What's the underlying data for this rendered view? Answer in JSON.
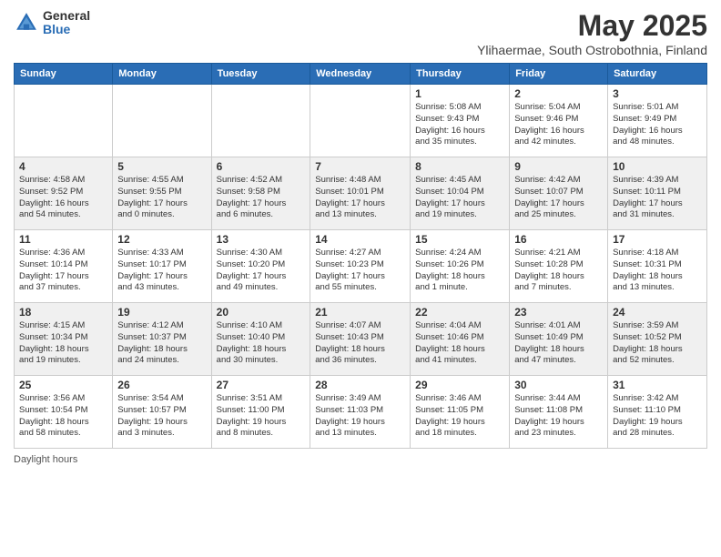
{
  "logo": {
    "general": "General",
    "blue": "Blue"
  },
  "title": "May 2025",
  "subtitle": "Ylihaermae, South Ostrobothnia, Finland",
  "headers": [
    "Sunday",
    "Monday",
    "Tuesday",
    "Wednesday",
    "Thursday",
    "Friday",
    "Saturday"
  ],
  "days_label": "Daylight hours",
  "weeks": [
    [
      {
        "num": "",
        "info": ""
      },
      {
        "num": "",
        "info": ""
      },
      {
        "num": "",
        "info": ""
      },
      {
        "num": "",
        "info": ""
      },
      {
        "num": "1",
        "info": "Sunrise: 5:08 AM\nSunset: 9:43 PM\nDaylight: 16 hours\nand 35 minutes."
      },
      {
        "num": "2",
        "info": "Sunrise: 5:04 AM\nSunset: 9:46 PM\nDaylight: 16 hours\nand 42 minutes."
      },
      {
        "num": "3",
        "info": "Sunrise: 5:01 AM\nSunset: 9:49 PM\nDaylight: 16 hours\nand 48 minutes."
      }
    ],
    [
      {
        "num": "4",
        "info": "Sunrise: 4:58 AM\nSunset: 9:52 PM\nDaylight: 16 hours\nand 54 minutes."
      },
      {
        "num": "5",
        "info": "Sunrise: 4:55 AM\nSunset: 9:55 PM\nDaylight: 17 hours\nand 0 minutes."
      },
      {
        "num": "6",
        "info": "Sunrise: 4:52 AM\nSunset: 9:58 PM\nDaylight: 17 hours\nand 6 minutes."
      },
      {
        "num": "7",
        "info": "Sunrise: 4:48 AM\nSunset: 10:01 PM\nDaylight: 17 hours\nand 13 minutes."
      },
      {
        "num": "8",
        "info": "Sunrise: 4:45 AM\nSunset: 10:04 PM\nDaylight: 17 hours\nand 19 minutes."
      },
      {
        "num": "9",
        "info": "Sunrise: 4:42 AM\nSunset: 10:07 PM\nDaylight: 17 hours\nand 25 minutes."
      },
      {
        "num": "10",
        "info": "Sunrise: 4:39 AM\nSunset: 10:11 PM\nDaylight: 17 hours\nand 31 minutes."
      }
    ],
    [
      {
        "num": "11",
        "info": "Sunrise: 4:36 AM\nSunset: 10:14 PM\nDaylight: 17 hours\nand 37 minutes."
      },
      {
        "num": "12",
        "info": "Sunrise: 4:33 AM\nSunset: 10:17 PM\nDaylight: 17 hours\nand 43 minutes."
      },
      {
        "num": "13",
        "info": "Sunrise: 4:30 AM\nSunset: 10:20 PM\nDaylight: 17 hours\nand 49 minutes."
      },
      {
        "num": "14",
        "info": "Sunrise: 4:27 AM\nSunset: 10:23 PM\nDaylight: 17 hours\nand 55 minutes."
      },
      {
        "num": "15",
        "info": "Sunrise: 4:24 AM\nSunset: 10:26 PM\nDaylight: 18 hours\nand 1 minute."
      },
      {
        "num": "16",
        "info": "Sunrise: 4:21 AM\nSunset: 10:28 PM\nDaylight: 18 hours\nand 7 minutes."
      },
      {
        "num": "17",
        "info": "Sunrise: 4:18 AM\nSunset: 10:31 PM\nDaylight: 18 hours\nand 13 minutes."
      }
    ],
    [
      {
        "num": "18",
        "info": "Sunrise: 4:15 AM\nSunset: 10:34 PM\nDaylight: 18 hours\nand 19 minutes."
      },
      {
        "num": "19",
        "info": "Sunrise: 4:12 AM\nSunset: 10:37 PM\nDaylight: 18 hours\nand 24 minutes."
      },
      {
        "num": "20",
        "info": "Sunrise: 4:10 AM\nSunset: 10:40 PM\nDaylight: 18 hours\nand 30 minutes."
      },
      {
        "num": "21",
        "info": "Sunrise: 4:07 AM\nSunset: 10:43 PM\nDaylight: 18 hours\nand 36 minutes."
      },
      {
        "num": "22",
        "info": "Sunrise: 4:04 AM\nSunset: 10:46 PM\nDaylight: 18 hours\nand 41 minutes."
      },
      {
        "num": "23",
        "info": "Sunrise: 4:01 AM\nSunset: 10:49 PM\nDaylight: 18 hours\nand 47 minutes."
      },
      {
        "num": "24",
        "info": "Sunrise: 3:59 AM\nSunset: 10:52 PM\nDaylight: 18 hours\nand 52 minutes."
      }
    ],
    [
      {
        "num": "25",
        "info": "Sunrise: 3:56 AM\nSunset: 10:54 PM\nDaylight: 18 hours\nand 58 minutes."
      },
      {
        "num": "26",
        "info": "Sunrise: 3:54 AM\nSunset: 10:57 PM\nDaylight: 19 hours\nand 3 minutes."
      },
      {
        "num": "27",
        "info": "Sunrise: 3:51 AM\nSunset: 11:00 PM\nDaylight: 19 hours\nand 8 minutes."
      },
      {
        "num": "28",
        "info": "Sunrise: 3:49 AM\nSunset: 11:03 PM\nDaylight: 19 hours\nand 13 minutes."
      },
      {
        "num": "29",
        "info": "Sunrise: 3:46 AM\nSunset: 11:05 PM\nDaylight: 19 hours\nand 18 minutes."
      },
      {
        "num": "30",
        "info": "Sunrise: 3:44 AM\nSunset: 11:08 PM\nDaylight: 19 hours\nand 23 minutes."
      },
      {
        "num": "31",
        "info": "Sunrise: 3:42 AM\nSunset: 11:10 PM\nDaylight: 19 hours\nand 28 minutes."
      }
    ]
  ]
}
